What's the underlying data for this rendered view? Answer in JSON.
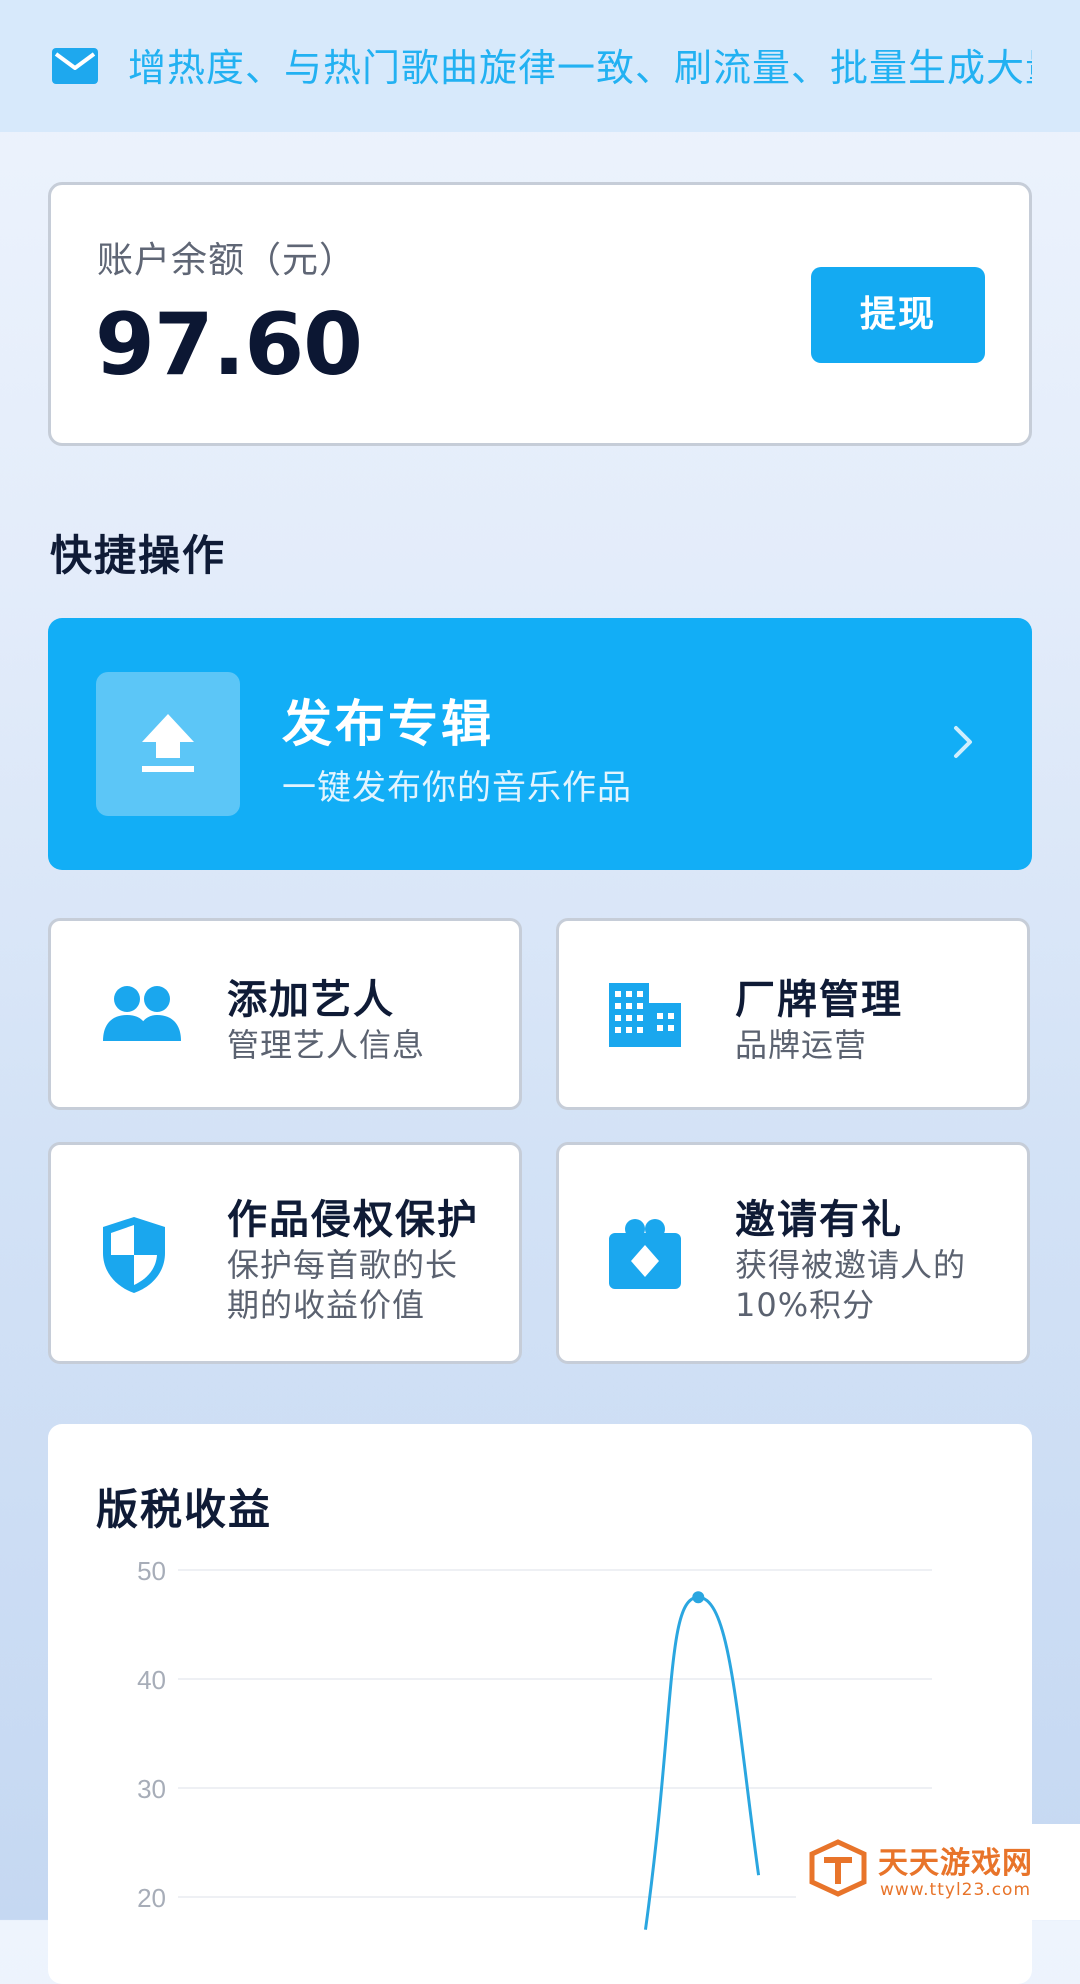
{
  "notice": {
    "icon": "mail-icon",
    "text": "增热度、与热门歌曲旋律一致、刷流量、批量生成大量"
  },
  "balance": {
    "label": "账户余额（元）",
    "amount": "97.60",
    "withdraw_label": "提现"
  },
  "quick_actions": {
    "title": "快捷操作"
  },
  "publish": {
    "icon": "upload-icon",
    "title": "发布专辑",
    "subtitle": "一键发布你的音乐作品"
  },
  "features": [
    {
      "icon": "users-icon",
      "title": "添加艺人",
      "desc": "管理艺人信息"
    },
    {
      "icon": "building-icon",
      "title": "厂牌管理",
      "desc": "品牌运营"
    },
    {
      "icon": "shield-icon",
      "title": "作品侵权保护",
      "desc": "保护每首歌的长期的收益价值"
    },
    {
      "icon": "gift-icon",
      "title": "邀请有礼",
      "desc": "获得被邀请人的10%积分"
    }
  ],
  "royalty": {
    "title": "版税收益"
  },
  "chart_data": {
    "type": "line",
    "title": "版税收益",
    "y_ticks": [
      50,
      40,
      30,
      20
    ],
    "ylim": [
      20,
      50
    ],
    "points": [
      {
        "x": 0.62,
        "y": 17
      },
      {
        "x": 0.69,
        "y": 47.5
      },
      {
        "x": 0.77,
        "y": 22
      }
    ],
    "marker_index": 1,
    "grid": true,
    "line_color": "#2aa6e0"
  },
  "watermark": {
    "name": "天天游戏网",
    "url": "www.ttyl23.com"
  },
  "colors": {
    "accent": "#14aaf2",
    "notice_text": "#22b1f2",
    "icon": "#1aa7ee"
  }
}
